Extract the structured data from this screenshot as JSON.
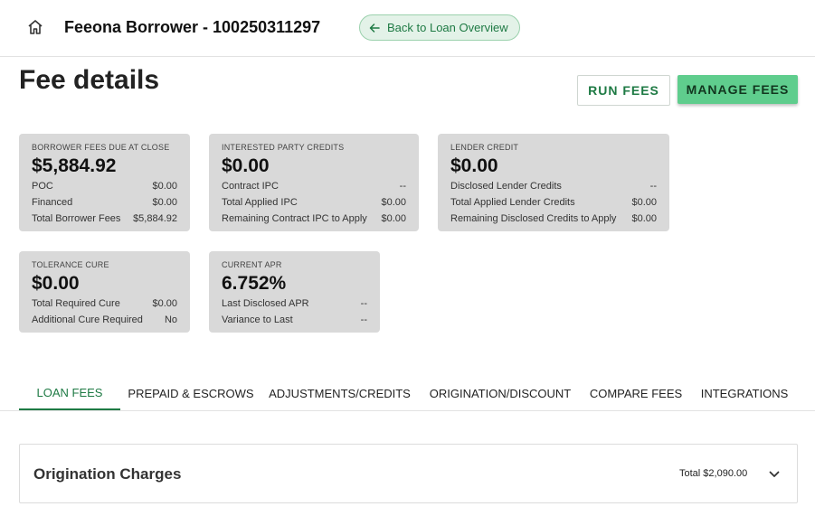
{
  "header": {
    "loan_title": "Feeona Borrower - 100250311297",
    "back_label": "Back to Loan Overview"
  },
  "page": {
    "title": "Fee details",
    "run_fees_label": "RUN FEES",
    "manage_fees_label": "MANAGE FEES"
  },
  "cards": {
    "borrower_fees": {
      "label": "BORROWER FEES DUE AT CLOSE",
      "value": "$5,884.92",
      "rows": [
        {
          "label": "POC",
          "value": "$0.00"
        },
        {
          "label": "Financed",
          "value": "$0.00"
        },
        {
          "label": "Total Borrower Fees",
          "value": "$5,884.92"
        }
      ]
    },
    "ipc": {
      "label": "INTERESTED PARTY CREDITS",
      "value": "$0.00",
      "rows": [
        {
          "label": "Contract IPC",
          "value": "--"
        },
        {
          "label": "Total Applied IPC",
          "value": "$0.00"
        },
        {
          "label": "Remaining Contract IPC to Apply",
          "value": "$0.00"
        }
      ]
    },
    "lender_credit": {
      "label": "LENDER CREDIT",
      "value": "$0.00",
      "rows": [
        {
          "label": "Disclosed Lender Credits",
          "value": "--"
        },
        {
          "label": "Total Applied Lender Credits",
          "value": "$0.00"
        },
        {
          "label": "Remaining Disclosed Credits to Apply",
          "value": "$0.00"
        }
      ]
    },
    "tolerance_cure": {
      "label": "TOLERANCE CURE",
      "value": "$0.00",
      "rows": [
        {
          "label": "Total Required Cure",
          "value": "$0.00"
        },
        {
          "label": "Additional Cure Required",
          "value": "No"
        }
      ]
    },
    "current_apr": {
      "label": "CURRENT APR",
      "value": "6.752%",
      "rows": [
        {
          "label": "Last Disclosed APR",
          "value": "--"
        },
        {
          "label": "Variance to Last",
          "value": "--"
        }
      ]
    }
  },
  "tabs": [
    {
      "label": "LOAN FEES",
      "active": true
    },
    {
      "label": "PREPAID & ESCROWS"
    },
    {
      "label": "ADJUSTMENTS/CREDITS"
    },
    {
      "label": "ORIGINATION/DISCOUNT"
    },
    {
      "label": "COMPARE FEES"
    },
    {
      "label": "INTEGRATIONS"
    }
  ],
  "section": {
    "title": "Origination Charges",
    "total": "Total $2,090.00"
  },
  "colors": {
    "accent": "#1e7a44",
    "manage_button": "#5fcd8d",
    "card_bg": "#d9d9d9",
    "back_button_bg": "#e3f2e8"
  },
  "icons": {
    "home": "home-icon",
    "back": "arrow-left-icon",
    "expand": "chevron-down-icon"
  }
}
